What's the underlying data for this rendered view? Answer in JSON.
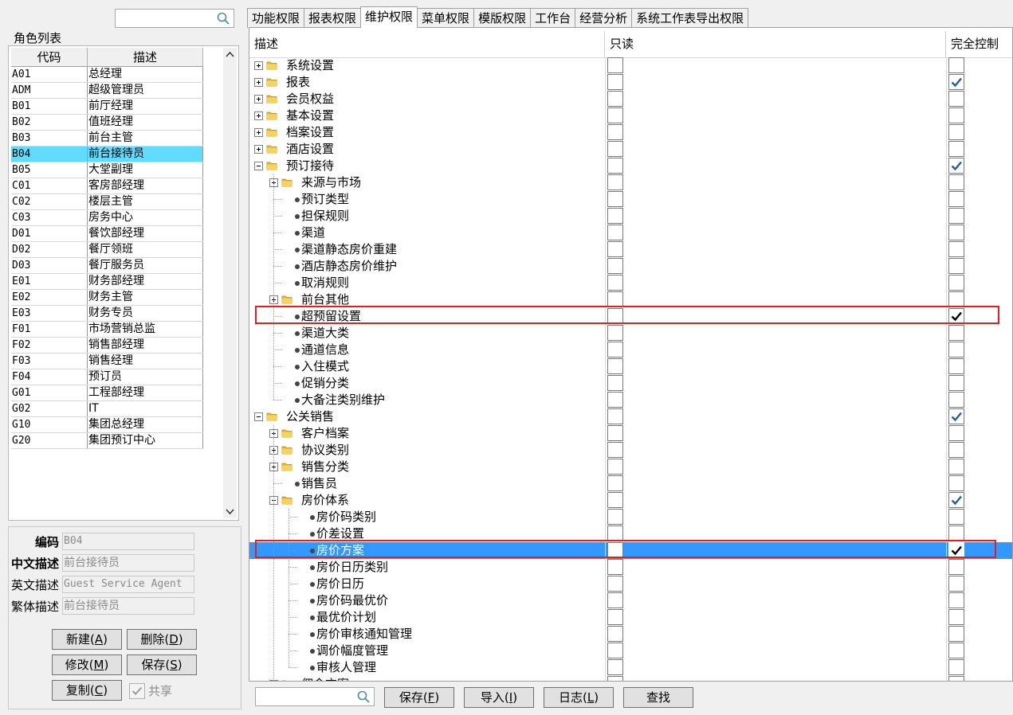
{
  "left": {
    "role_list_label": "角色列表",
    "table_headers": {
      "code": "代码",
      "desc": "描述"
    },
    "roles": [
      {
        "code": "A01",
        "desc": "总经理"
      },
      {
        "code": "ADM",
        "desc": "超级管理员"
      },
      {
        "code": "B01",
        "desc": "前厅经理"
      },
      {
        "code": "B02",
        "desc": "值班经理"
      },
      {
        "code": "B03",
        "desc": "前台主管"
      },
      {
        "code": "B04",
        "desc": "前台接待员",
        "selected": true
      },
      {
        "code": "B05",
        "desc": "大堂副理"
      },
      {
        "code": "C01",
        "desc": "客房部经理"
      },
      {
        "code": "C02",
        "desc": "楼层主管"
      },
      {
        "code": "C03",
        "desc": "房务中心"
      },
      {
        "code": "D01",
        "desc": "餐饮部经理"
      },
      {
        "code": "D02",
        "desc": "餐厅领班"
      },
      {
        "code": "D03",
        "desc": "餐厅服务员"
      },
      {
        "code": "E01",
        "desc": "财务部经理"
      },
      {
        "code": "E02",
        "desc": "财务主管"
      },
      {
        "code": "E03",
        "desc": "财务专员"
      },
      {
        "code": "F01",
        "desc": "市场营销总监"
      },
      {
        "code": "F02",
        "desc": "销售部经理"
      },
      {
        "code": "F03",
        "desc": "销售经理"
      },
      {
        "code": "F04",
        "desc": "预订员"
      },
      {
        "code": "G01",
        "desc": "工程部经理"
      },
      {
        "code": "G02",
        "desc": "IT"
      },
      {
        "code": "G10",
        "desc": "集团总经理"
      },
      {
        "code": "G20",
        "desc": "集团预订中心"
      }
    ],
    "fields": {
      "code_label": "编码",
      "code_value": "B04",
      "cn_label": "中文描述",
      "cn_value": "前台接待员",
      "en_label": "英文描述",
      "en_value": "Guest Service Agent",
      "tw_label": "繁体描述",
      "tw_value": "前台接待员"
    },
    "buttons": {
      "new": "新建",
      "new_key": "A",
      "delete": "删除",
      "delete_key": "D",
      "modify": "修改",
      "modify_key": "M",
      "save": "保存",
      "save_key": "S",
      "copy": "复制",
      "copy_key": "C",
      "share": "共享"
    }
  },
  "tabs": [
    "功能权限",
    "报表权限",
    "维护权限",
    "菜单权限",
    "模版权限",
    "工作台",
    "经营分析",
    "系统工作表导出权限"
  ],
  "active_tab": 2,
  "grid": {
    "headers": {
      "desc": "描述",
      "readonly": "只读",
      "full": "完全控制"
    },
    "rows": [
      {
        "label": "系统设置",
        "level": 0,
        "kind": "folder",
        "exp": "plus",
        "full": false
      },
      {
        "label": "报表",
        "level": 0,
        "kind": "folder",
        "exp": "plus",
        "full": true
      },
      {
        "label": "会员权益",
        "level": 0,
        "kind": "folder",
        "exp": "plus",
        "full": false
      },
      {
        "label": "基本设置",
        "level": 0,
        "kind": "folder",
        "exp": "plus",
        "full": false
      },
      {
        "label": "档案设置",
        "level": 0,
        "kind": "folder",
        "exp": "plus",
        "full": false
      },
      {
        "label": "酒店设置",
        "level": 0,
        "kind": "folder",
        "exp": "plus",
        "full": false
      },
      {
        "label": "预订接待",
        "level": 0,
        "kind": "folder",
        "exp": "minus",
        "full": true
      },
      {
        "label": "来源与市场",
        "level": 1,
        "kind": "folder",
        "exp": "plus",
        "full": false
      },
      {
        "label": "预订类型",
        "level": 1,
        "kind": "leaf",
        "full": false
      },
      {
        "label": "担保规则",
        "level": 1,
        "kind": "leaf",
        "full": false
      },
      {
        "label": "渠道",
        "level": 1,
        "kind": "leaf",
        "full": false
      },
      {
        "label": "渠道静态房价重建",
        "level": 1,
        "kind": "leaf",
        "full": false
      },
      {
        "label": "酒店静态房价维护",
        "level": 1,
        "kind": "leaf",
        "full": false
      },
      {
        "label": "取消规则",
        "level": 1,
        "kind": "leaf",
        "full": false
      },
      {
        "label": "前台其他",
        "level": 1,
        "kind": "folder",
        "exp": "plus",
        "full": false
      },
      {
        "label": "超预留设置",
        "level": 1,
        "kind": "leaf",
        "full": true,
        "highlight": true,
        "plaincheck": true
      },
      {
        "label": "渠道大类",
        "level": 1,
        "kind": "leaf",
        "full": false
      },
      {
        "label": "通道信息",
        "level": 1,
        "kind": "leaf",
        "full": false
      },
      {
        "label": "入住模式",
        "level": 1,
        "kind": "leaf",
        "full": false
      },
      {
        "label": "促销分类",
        "level": 1,
        "kind": "leaf",
        "full": false
      },
      {
        "label": "大备注类别维护",
        "level": 1,
        "kind": "leaf",
        "full": false
      },
      {
        "label": "公关销售",
        "level": 0,
        "kind": "folder",
        "exp": "minus",
        "full": true
      },
      {
        "label": "客户档案",
        "level": 1,
        "kind": "folder",
        "exp": "plus",
        "full": false
      },
      {
        "label": "协议类别",
        "level": 1,
        "kind": "folder",
        "exp": "plus",
        "full": false
      },
      {
        "label": "销售分类",
        "level": 1,
        "kind": "folder",
        "exp": "plus",
        "full": false
      },
      {
        "label": "销售员",
        "level": 1,
        "kind": "leaf",
        "full": false
      },
      {
        "label": "房价体系",
        "level": 1,
        "kind": "folder",
        "exp": "minus",
        "full": true
      },
      {
        "label": "房价码类别",
        "level": 2,
        "kind": "leaf",
        "full": false
      },
      {
        "label": "价差设置",
        "level": 2,
        "kind": "leaf",
        "full": false
      },
      {
        "label": "房价方案",
        "level": 2,
        "kind": "leaf",
        "full": true,
        "selected": true,
        "highlight": true,
        "plaincheck": true
      },
      {
        "label": "房价日历类别",
        "level": 2,
        "kind": "leaf",
        "full": false
      },
      {
        "label": "房价日历",
        "level": 2,
        "kind": "leaf",
        "full": false
      },
      {
        "label": "房价码最优价",
        "level": 2,
        "kind": "leaf",
        "full": false
      },
      {
        "label": "最优价计划",
        "level": 2,
        "kind": "leaf",
        "full": false
      },
      {
        "label": "房价审核通知管理",
        "level": 2,
        "kind": "leaf",
        "full": false
      },
      {
        "label": "调价幅度管理",
        "level": 2,
        "kind": "leaf",
        "full": false
      },
      {
        "label": "审核人管理",
        "level": 2,
        "kind": "leaf",
        "full": false
      },
      {
        "label": "佣金方案",
        "level": 1,
        "kind": "folder",
        "exp": "plus",
        "full": false
      }
    ]
  },
  "bottom": {
    "save": "保存",
    "save_key": "F",
    "import": "导入",
    "import_key": "I",
    "log": "日志",
    "log_key": "L",
    "find": "查找"
  },
  "colors": {
    "selected_role": "#5fdcff",
    "selected_row": "#3399ff",
    "check": "#1f5f9f",
    "highlight_box": "#e02020"
  }
}
